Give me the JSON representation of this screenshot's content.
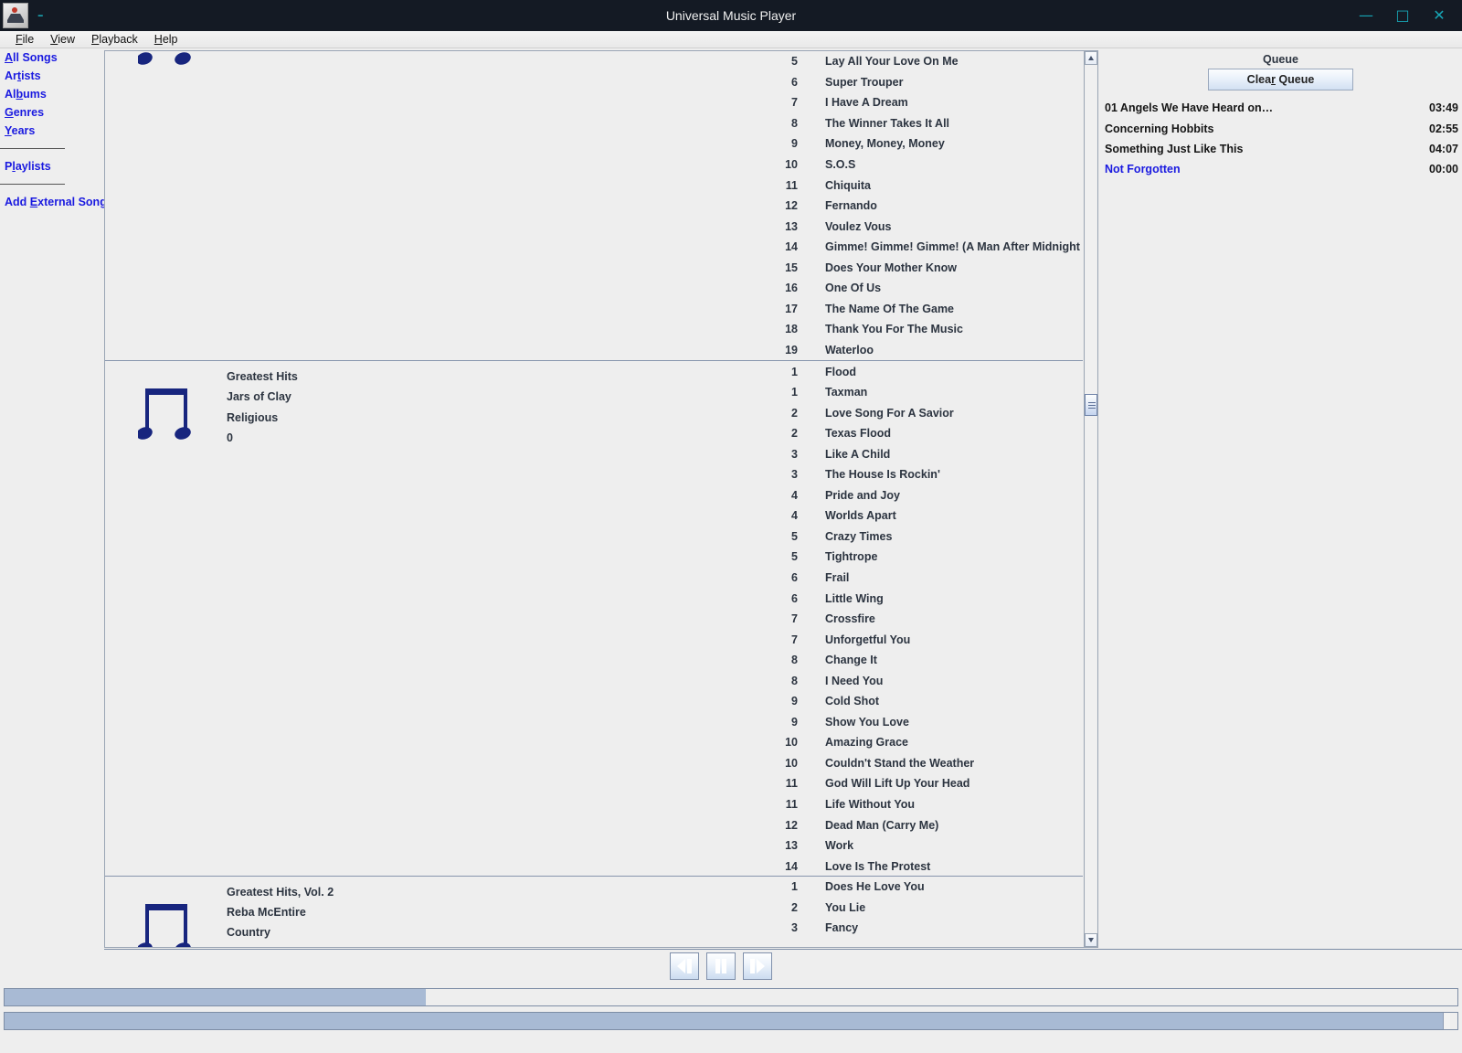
{
  "window": {
    "title": "Universal Music Player",
    "icon": "app-music-icon",
    "controls": {
      "minimize": "—",
      "maximize": "▣",
      "close": "✕"
    },
    "accent_color": "#17a5b5",
    "titlebar_color": "#141a24"
  },
  "menubar": {
    "items": [
      {
        "label": "File",
        "mnemonic": "F"
      },
      {
        "label": "View",
        "mnemonic": "V"
      },
      {
        "label": "Playback",
        "mnemonic": "P"
      },
      {
        "label": "Help",
        "mnemonic": "H"
      }
    ]
  },
  "sidebar": {
    "link_color": "#1a1ae0",
    "groups": [
      {
        "items": [
          {
            "label": "All Songs",
            "mnemonic": "A"
          },
          {
            "label": "Artists",
            "mnemonic": "t"
          },
          {
            "label": "Albums",
            "mnemonic": "b"
          },
          {
            "label": "Genres",
            "mnemonic": "G"
          },
          {
            "label": "Years",
            "mnemonic": "Y"
          }
        ]
      },
      {
        "items": [
          {
            "label": "Playlists",
            "mnemonic": "l"
          }
        ]
      },
      {
        "items": [
          {
            "label": "Add External Song",
            "mnemonic": "E"
          }
        ]
      }
    ]
  },
  "library": {
    "albums": [
      {
        "album": "",
        "artist": "",
        "genre": "",
        "year": "",
        "partial": true,
        "art": "music-note-icon",
        "tracks": [
          {
            "num": "5",
            "title": "Lay All Your Love On Me"
          },
          {
            "num": "6",
            "title": "Super Trouper"
          },
          {
            "num": "7",
            "title": "I Have A Dream"
          },
          {
            "num": "8",
            "title": "The Winner Takes It All"
          },
          {
            "num": "9",
            "title": "Money, Money, Money"
          },
          {
            "num": "10",
            "title": "S.O.S"
          },
          {
            "num": "11",
            "title": "Chiquita"
          },
          {
            "num": "12",
            "title": "Fernando"
          },
          {
            "num": "13",
            "title": "Voulez Vous"
          },
          {
            "num": "14",
            "title": "Gimme! Gimme! Gimme! (A Man After Midnight )"
          },
          {
            "num": "15",
            "title": "Does Your Mother Know"
          },
          {
            "num": "16",
            "title": "One Of Us"
          },
          {
            "num": "17",
            "title": "The Name Of The Game"
          },
          {
            "num": "18",
            "title": "Thank You For The Music"
          },
          {
            "num": "19",
            "title": "Waterloo"
          }
        ]
      },
      {
        "album": "Greatest Hits",
        "artist": "Jars of Clay",
        "genre": "Religious",
        "year": "0",
        "partial": false,
        "art": "music-note-icon",
        "tracks": [
          {
            "num": "1",
            "title": "Flood"
          },
          {
            "num": "1",
            "title": "Taxman"
          },
          {
            "num": "2",
            "title": "Love Song For A Savior"
          },
          {
            "num": "2",
            "title": "Texas Flood"
          },
          {
            "num": "3",
            "title": "Like A Child"
          },
          {
            "num": "3",
            "title": "The House Is Rockin'"
          },
          {
            "num": "4",
            "title": "Pride and Joy"
          },
          {
            "num": "4",
            "title": "Worlds Apart"
          },
          {
            "num": "5",
            "title": "Crazy Times"
          },
          {
            "num": "5",
            "title": "Tightrope"
          },
          {
            "num": "6",
            "title": "Frail"
          },
          {
            "num": "6",
            "title": "Little Wing"
          },
          {
            "num": "7",
            "title": "Crossfire"
          },
          {
            "num": "7",
            "title": "Unforgetful You"
          },
          {
            "num": "8",
            "title": "Change It"
          },
          {
            "num": "8",
            "title": "I Need You"
          },
          {
            "num": "9",
            "title": "Cold Shot"
          },
          {
            "num": "9",
            "title": "Show You Love"
          },
          {
            "num": "10",
            "title": "Amazing Grace"
          },
          {
            "num": "10",
            "title": "Couldn't Stand the Weather"
          },
          {
            "num": "11",
            "title": "God Will Lift Up Your Head"
          },
          {
            "num": "11",
            "title": "Life Without You"
          },
          {
            "num": "12",
            "title": "Dead Man (Carry Me)"
          },
          {
            "num": "13",
            "title": "Work"
          },
          {
            "num": "14",
            "title": "Love Is The Protest"
          }
        ]
      },
      {
        "album": "Greatest Hits, Vol. 2",
        "artist": "Reba McEntire",
        "genre": "Country",
        "year": "",
        "partial": false,
        "art": "music-note-icon",
        "tracks": [
          {
            "num": "1",
            "title": "Does He Love You"
          },
          {
            "num": "2",
            "title": "You Lie"
          },
          {
            "num": "3",
            "title": "Fancy"
          }
        ]
      }
    ]
  },
  "queue": {
    "title": "Queue",
    "clear_label_before": "Clea",
    "clear_mnemonic": "r",
    "clear_label_after": " Queue",
    "items": [
      {
        "name": "01 Angels We Have Heard on…",
        "time": "03:49",
        "playing": false
      },
      {
        "name": "Concerning Hobbits",
        "time": "02:55",
        "playing": false
      },
      {
        "name": "Something Just Like This",
        "time": "04:07",
        "playing": false
      },
      {
        "name": "Not Forgotten",
        "time": "00:00",
        "playing": true
      }
    ]
  },
  "transport": {
    "buttons": [
      {
        "name": "previous-button",
        "glyph": "prev"
      },
      {
        "name": "pause-button",
        "glyph": "pause"
      },
      {
        "name": "next-button",
        "glyph": "next"
      }
    ]
  },
  "sliders": {
    "seek": {
      "name": "seek-slider",
      "percent": 29
    },
    "volume": {
      "name": "volume-slider",
      "percent": 99
    }
  }
}
